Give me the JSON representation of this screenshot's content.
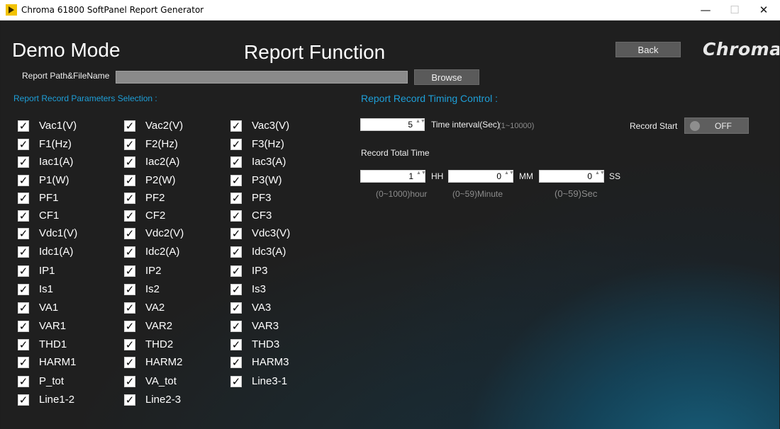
{
  "window": {
    "title": "Chroma 61800 SoftPanel Report Generator",
    "minimize": "—",
    "maximize": "☐",
    "close": "✕"
  },
  "header": {
    "mode": "Demo Mode",
    "title": "Report Function",
    "back_label": "Back",
    "logo_text": "Chroma"
  },
  "path": {
    "label": "Report Path&FileName",
    "value": "",
    "browse_label": "Browse"
  },
  "params": {
    "section_title": "Report Record Parameters Selection :",
    "columns": [
      [
        "Vac1(V)",
        "F1(Hz)",
        "Iac1(A)",
        "P1(W)",
        "PF1",
        "CF1",
        "Vdc1(V)",
        "Idc1(A)",
        "IP1",
        "Is1",
        "VA1",
        "VAR1",
        "THD1",
        "HARM1",
        "P_tot",
        "Line1-2"
      ],
      [
        "Vac2(V)",
        "F2(Hz)",
        "Iac2(A)",
        "P2(W)",
        "PF2",
        "CF2",
        "Vdc2(V)",
        "Idc2(A)",
        "IP2",
        "Is2",
        "VA2",
        "VAR2",
        "THD2",
        "HARM2",
        "VA_tot",
        "Line2-3"
      ],
      [
        "Vac3(V)",
        "F3(Hz)",
        "Iac3(A)",
        "P3(W)",
        "PF3",
        "CF3",
        "Vdc3(V)",
        "Idc3(A)",
        "IP3",
        "Is3",
        "VA3",
        "VAR3",
        "THD3",
        "HARM3",
        "Line3-1"
      ]
    ],
    "check_glyph": "✓"
  },
  "timing": {
    "section_title": "Report Record Timing Control :",
    "interval_value": "5",
    "interval_label": "Time interval(Sec)",
    "interval_range": "(1~10000)",
    "record_start_label": "Record Start",
    "toggle_state": "OFF",
    "total_time_label": "Record Total Time",
    "hh_value": "1",
    "hh_label": "HH",
    "hh_range": "(0~1000)hour",
    "mm_value": "0",
    "mm_label": "MM",
    "mm_range": "(0~59)Minute",
    "ss_value": "0",
    "ss_label": "SS",
    "ss_range": "(0~59)Sec",
    "spin_arrows": "▲▼"
  },
  "colors": {
    "accent": "#1e9fd8",
    "background": "#1f1f1f",
    "button": "#5a5a5a"
  }
}
